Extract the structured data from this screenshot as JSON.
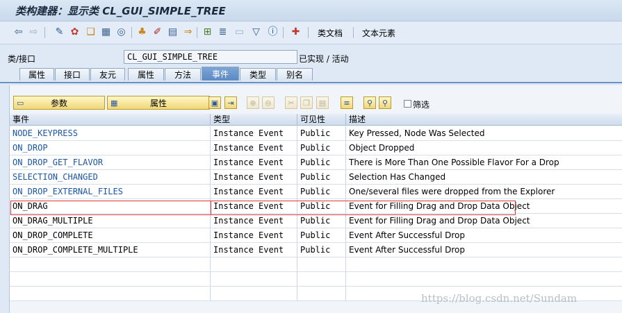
{
  "window": {
    "title": "类构建器：显示类 CL_GUI_SIMPLE_TREE"
  },
  "toolbar": {
    "class_docs_label": "类文档",
    "text_elements_label": "文本元素"
  },
  "class_field": {
    "label": "类/接口",
    "value": "CL_GUI_SIMPLE_TREE",
    "status": "已实现 / 活动"
  },
  "tabs": [
    {
      "label": "属性"
    },
    {
      "label": "接口"
    },
    {
      "label": "友元"
    },
    {
      "label": "属性"
    },
    {
      "label": "方法"
    },
    {
      "label": "事件",
      "active": true
    },
    {
      "label": "类型"
    },
    {
      "label": "别名"
    }
  ],
  "alv_toolbar": {
    "params_label": "参数",
    "attributes_label": "属性",
    "filter_label": "筛选"
  },
  "grid": {
    "columns": [
      "事件",
      "类型",
      "可见性",
      "描述"
    ],
    "rows": [
      {
        "event": "NODE_KEYPRESS",
        "type": "Instance Event",
        "visibility": "Public",
        "desc": "Key Pressed, Node Was Selected",
        "link": true
      },
      {
        "event": "ON_DROP",
        "type": "Instance Event",
        "visibility": "Public",
        "desc": "Object Dropped",
        "link": true
      },
      {
        "event": "ON_DROP_GET_FLAVOR",
        "type": "Instance Event",
        "visibility": "Public",
        "desc": "There is More Than One Possible Flavor For a Drop",
        "link": true
      },
      {
        "event": "SELECTION_CHANGED",
        "type": "Instance Event",
        "visibility": "Public",
        "desc": "Selection Has Changed",
        "link": true
      },
      {
        "event": "ON_DROP_EXTERNAL_FILES",
        "type": "Instance Event",
        "visibility": "Public",
        "desc": "One/several files were dropped from the Explorer",
        "link": true
      },
      {
        "event": "ON_DRAG",
        "type": "Instance Event",
        "visibility": "Public",
        "desc": "Event for Filling Drag and Drop Data Object",
        "link": false
      },
      {
        "event": "ON_DRAG_MULTIPLE",
        "type": "Instance Event",
        "visibility": "Public",
        "desc": "Event for Filling Drag and Drop Data Object",
        "link": false
      },
      {
        "event": "ON_DROP_COMPLETE",
        "type": "Instance Event",
        "visibility": "Public",
        "desc": "Event After Successful Drop",
        "link": false
      },
      {
        "event": "ON_DROP_COMPLETE_MULTIPLE",
        "type": "Instance Event",
        "visibility": "Public",
        "desc": "Event After Successful Drop",
        "link": false
      }
    ]
  },
  "watermark": "https://blog.csdn.net/Sundam"
}
